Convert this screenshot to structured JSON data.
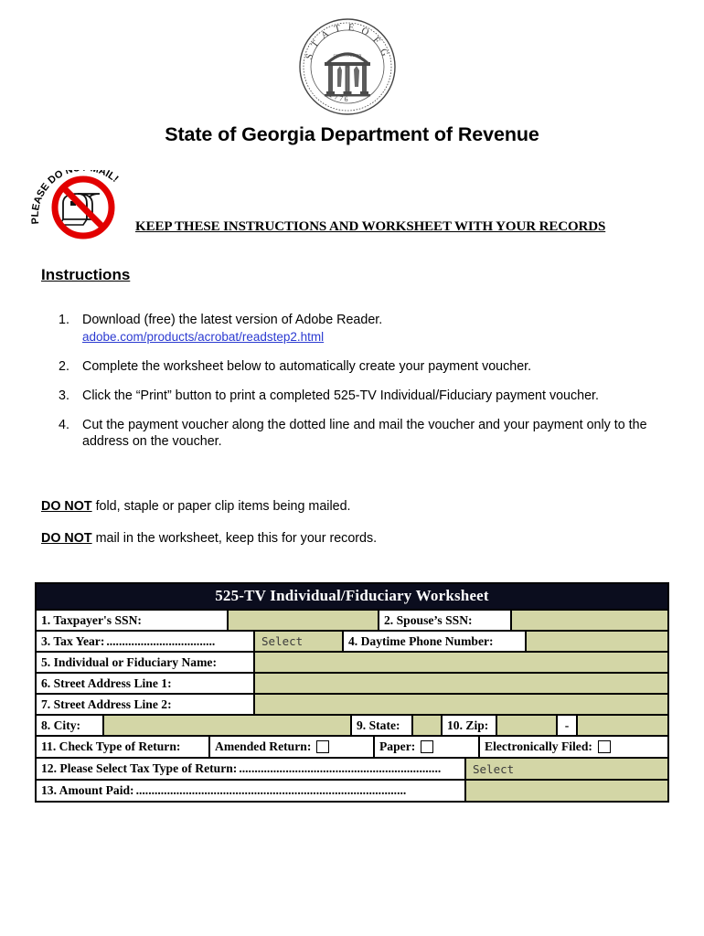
{
  "seal": {
    "name": "state-of-georgia-seal",
    "outer_text": "STATE OF GEORGIA",
    "year": "1776",
    "motto": "WISDOM JUSTICE MODERATION"
  },
  "header": {
    "title": "State of Georgia Department of Revenue"
  },
  "nomail": {
    "badge_text": "PLEASE DO NOT MAIL!",
    "notice": "KEEP THESE INSTRUCTIONS AND WORKSHEET WITH YOUR RECORDS"
  },
  "instructions": {
    "heading": "Instructions",
    "steps": [
      {
        "num": "1.",
        "text": "Download (free) the latest version of Adobe Reader.",
        "link": "adobe.com/products/acrobat/readstep2.html"
      },
      {
        "num": "2.",
        "text": "Complete the worksheet below to automatically create your payment voucher.",
        "link": ""
      },
      {
        "num": "3.",
        "text": "Click the “Print” button to print a completed 525-TV Individual/Fiduciary payment voucher.",
        "link": ""
      },
      {
        "num": "4.",
        "text": "Cut the payment voucher along the dotted line and mail the voucher and your payment only to the address on the voucher.",
        "link": ""
      }
    ]
  },
  "donot": {
    "strong": "DO NOT",
    "line1": " fold, staple or paper clip items being mailed.",
    "line2": " mail in the worksheet, keep this for your records."
  },
  "worksheet": {
    "title": "525-TV  Individual/Fiduciary Worksheet",
    "field_color": "#d3d6a6",
    "header_color": "#0b0d1e",
    "row1": {
      "label_ssn": "1. Taxpayer's SSN:",
      "value_ssn": "",
      "label_spouse": "2.  Spouse’s SSN:",
      "value_spouse": ""
    },
    "row2": {
      "label_taxyear": "3.  Tax Year:",
      "dots_taxyear": "...................................",
      "value_taxyear": "Select",
      "label_phone": "4. Daytime Phone Number:",
      "value_phone": ""
    },
    "row3": {
      "label_name": "5.   Individual or Fiduciary Name:",
      "value_name": ""
    },
    "row4": {
      "label_addr1": "6.   Street Address Line 1:",
      "value_addr1": ""
    },
    "row5": {
      "label_addr2": "7.   Street Address Line 2:",
      "value_addr2": ""
    },
    "row6": {
      "label_city": "8.   City:",
      "value_city": "",
      "label_state": "9.  State:",
      "value_state": "",
      "label_zip": "10. Zip:",
      "value_zip": "",
      "zip_separator": "-",
      "value_zip4": ""
    },
    "row7": {
      "label_type": "11. Check Type of Return:",
      "opt_amended": "Amended Return:",
      "opt_paper": "Paper:",
      "opt_efiled": "Electronically Filed:"
    },
    "row8": {
      "label_taxtype": "12. Please Select Tax Type of Return:",
      "dots_taxtype": ".................................................................",
      "value_taxtype": "Select"
    },
    "row9": {
      "label_amount": "13. Amount Paid:",
      "dots_amount": ".......................................................................................",
      "value_amount": ""
    }
  }
}
